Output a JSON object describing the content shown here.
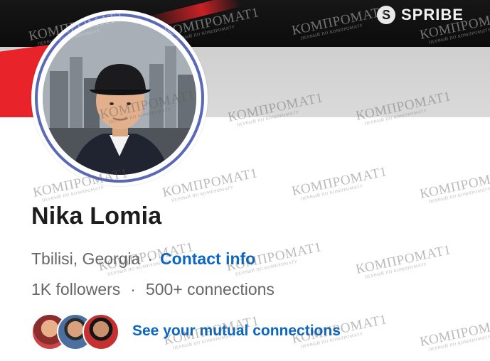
{
  "banner": {
    "logo_text": "SPRIBE"
  },
  "profile": {
    "name": "Nika Lomia",
    "location": "Tbilisi, Georgia",
    "separator": "·",
    "contact_info_label": "Contact info",
    "followers": "1K followers",
    "connections": "500+ connections",
    "stats_separator": "·",
    "mutual_connections_label": "See your mutual connections"
  },
  "watermark": {
    "text": "КОМПРОМАТ1",
    "subtext": "ПЕРВЫЙ ПО КОМПРОМАТУ"
  },
  "colors": {
    "link": "#0a66c2",
    "name": "#1d1d1d",
    "secondary_text": "#666666",
    "avatar_ring": "#5a68b8",
    "banner_red": "#e8242a"
  }
}
